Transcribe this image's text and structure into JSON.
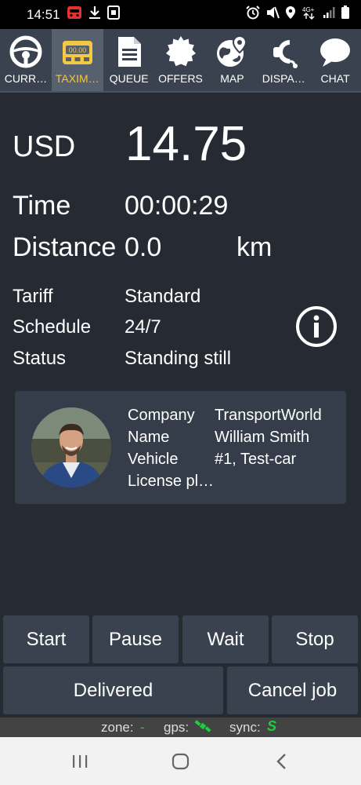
{
  "status_bar": {
    "time": "14:51",
    "left_icons": [
      "taxi-app-icon",
      "download-icon",
      "screenshot-icon"
    ],
    "right_icons": [
      "alarm-icon",
      "mute-icon",
      "location-icon",
      "network-4g-icon",
      "signal-icon",
      "battery-icon"
    ],
    "network_label": "4G+"
  },
  "nav": {
    "tabs": [
      {
        "label": "CURR…",
        "icon": "steering-wheel-icon",
        "active": false
      },
      {
        "label": "TAXIM…",
        "icon": "taximeter-icon",
        "active": true,
        "meter_text": "00.00"
      },
      {
        "label": "QUEUE",
        "icon": "document-icon",
        "active": false
      },
      {
        "label": "OFFERS",
        "icon": "badge-icon",
        "active": false
      },
      {
        "label": "MAP",
        "icon": "globe-pin-icon",
        "active": false
      },
      {
        "label": "DISPA…",
        "icon": "headset-icon",
        "active": false
      },
      {
        "label": "CHAT",
        "icon": "chat-bubble-icon",
        "active": false
      }
    ]
  },
  "fare": {
    "currency": "USD",
    "amount": "14.75"
  },
  "trip": {
    "time_label": "Time",
    "time_value": "00:00:29",
    "distance_label": "Distance",
    "distance_value": "0.0",
    "distance_unit": "km"
  },
  "details": {
    "tariff_label": "Tariff",
    "tariff_value": "Standard",
    "schedule_label": "Schedule",
    "schedule_value": "24/7",
    "status_label": "Status",
    "status_value": "Standing still"
  },
  "driver": {
    "company_label": "Company",
    "company_value": "TransportWorld",
    "name_label": "Name",
    "name_value": "William Smith",
    "vehicle_label": "Vehicle",
    "vehicle_value": "#1, Test-car",
    "license_label": "License pl…",
    "license_value": ""
  },
  "actions": {
    "start": "Start",
    "pause": "Pause",
    "wait": "Wait",
    "stop": "Stop",
    "delivered": "Delivered",
    "cancel_job": "Cancel job"
  },
  "footer_status": {
    "zone_label": "zone:",
    "zone_value": "-",
    "gps_label": "gps:",
    "sync_label": "sync:",
    "sync_value": "S"
  },
  "colors": {
    "background": "#262b33",
    "nav_background": "#3a4250",
    "nav_active": "#56606e",
    "active_label": "#f4c842",
    "card": "#353d4a",
    "button": "#3a4250",
    "status_green": "#19d13c"
  }
}
